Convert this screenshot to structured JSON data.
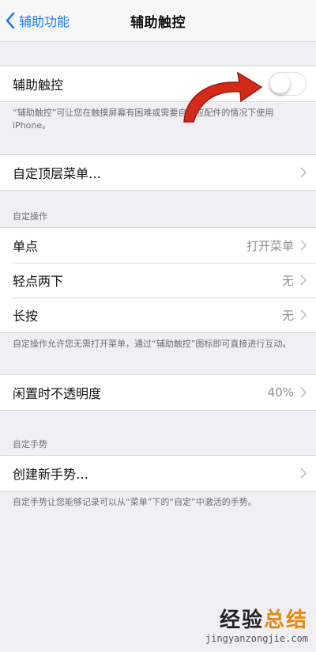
{
  "navbar": {
    "back_label": "辅助功能",
    "title": "辅助触控"
  },
  "assistive_touch": {
    "label": "辅助触控",
    "toggle_on": false,
    "footer": "“辅助触控”可让您在触摸屏幕有困难或需要自适应配件的情况下使用 iPhone。"
  },
  "top_menu": {
    "label": "自定顶层菜单…"
  },
  "custom_actions": {
    "header": "自定操作",
    "rows": [
      {
        "label": "单点",
        "value": "打开菜单"
      },
      {
        "label": "轻点两下",
        "value": "无"
      },
      {
        "label": "长按",
        "value": "无"
      }
    ],
    "footer": "自定操作允许您无需打开菜单，通过“辅助触控”图标即可直接进行互动。"
  },
  "idle_opacity": {
    "label": "闲置时不透明度",
    "value": "40%"
  },
  "custom_gestures": {
    "header": "自定手势",
    "create_label": "创建新手势…",
    "footer": "自定手势让您能够记录可以从“菜单”下的“自定”中激活的手势。"
  },
  "watermark": {
    "main_a": "经验",
    "main_b": "总结",
    "url": "jingyanzongjie.com"
  },
  "colors": {
    "accent": "#1a7cf5",
    "background": "#efeff4",
    "arrow": "#d32a1a"
  }
}
